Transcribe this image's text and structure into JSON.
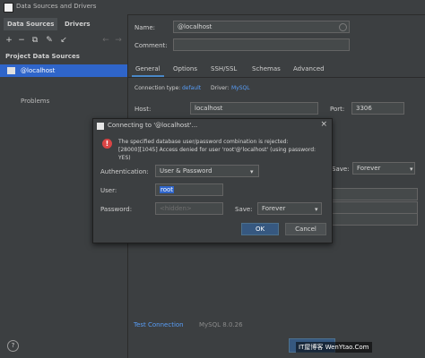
{
  "window": {
    "title": "Data Sources and Drivers"
  },
  "sidebar": {
    "tabs": [
      "Data Sources",
      "Drivers"
    ],
    "toolbar": [
      "+",
      "−",
      "⧉",
      "✎",
      "↙",
      "←",
      "→"
    ],
    "section_title": "Project Data Sources",
    "items": [
      {
        "label": "@localhost"
      }
    ],
    "problems_label": "Problems",
    "help": "?"
  },
  "form": {
    "name_label": "Name:",
    "name_value": "@localhost",
    "comment_label": "Comment:",
    "tabs": [
      "General",
      "Options",
      "SSH/SSL",
      "Schemas",
      "Advanced"
    ],
    "connection_type_label": "Connection type:",
    "connection_type_value": "default",
    "driver_label": "Driver:",
    "driver_value": "MySQL",
    "host_label": "Host:",
    "host_value": "localhost",
    "port_label": "Port:",
    "port_value": "3306",
    "save_label": "Save:",
    "save_value": "Forever",
    "test_connection": "Test Connection",
    "server_version": "MySQL 8.0.26"
  },
  "dialog": {
    "title": "Connecting to '@localhost'...",
    "error_line1": "The specified database user/password combination is rejected:",
    "error_line2": "[28000][1045] Access denied for user 'root'@'localhost' (using password: YES)",
    "auth_label": "Authentication:",
    "auth_value": "User & Password",
    "user_label": "User:",
    "user_value": "root",
    "password_label": "Password:",
    "password_placeholder": "<hidden>",
    "save_label": "Save:",
    "save_value": "Forever",
    "ok": "OK",
    "cancel": "Cancel"
  },
  "watermark": "IT屋博客 WenYtao.Com"
}
